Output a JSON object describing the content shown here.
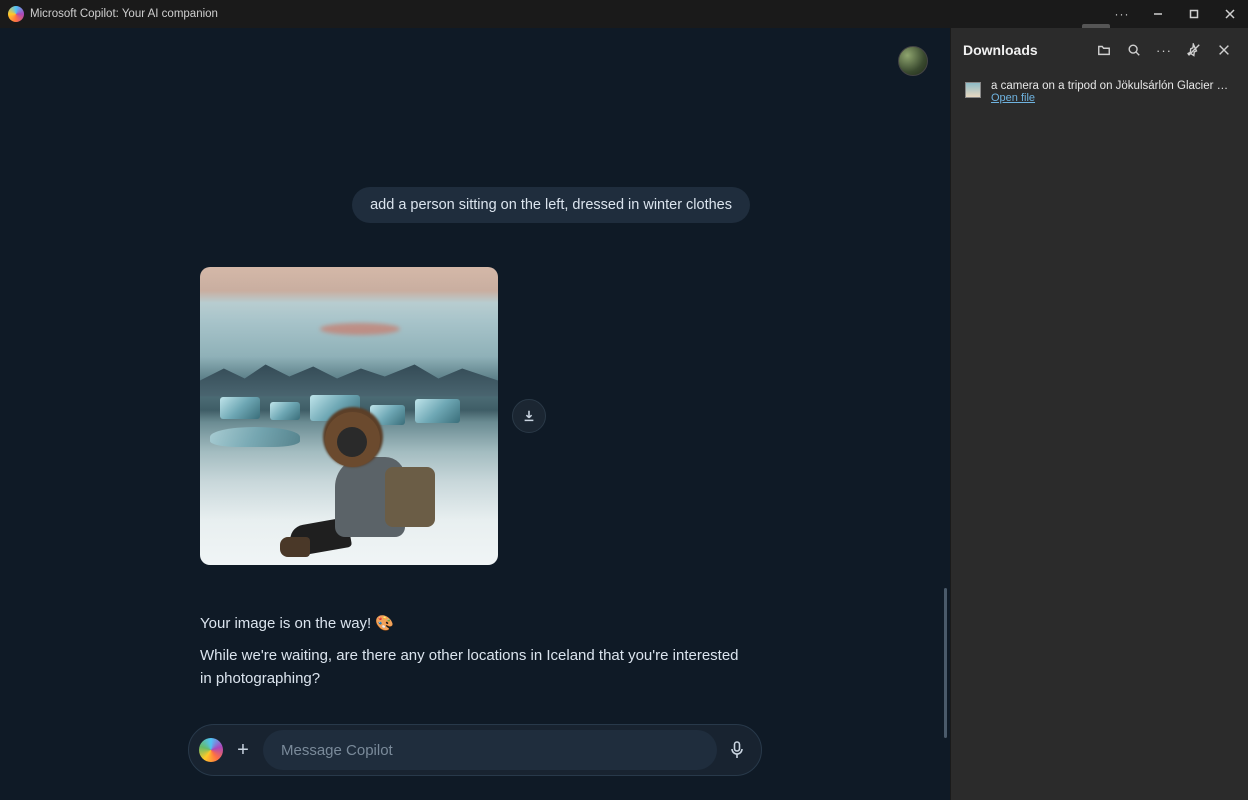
{
  "window": {
    "title": "Microsoft Copilot: Your AI companion"
  },
  "chat": {
    "user_message": "add a person sitting on the left, dressed in winter clothes",
    "assistant_line1": "Your image is on the way! 🎨",
    "assistant_line2": "While we're waiting, are there any other locations in Iceland that you're interested in photographing?"
  },
  "composer": {
    "placeholder": "Message Copilot"
  },
  "downloads": {
    "title": "Downloads",
    "items": [
      {
        "name": "a camera on a tripod on Jökulsárlón Glacier Lagoon.png",
        "action": "Open file"
      }
    ]
  }
}
